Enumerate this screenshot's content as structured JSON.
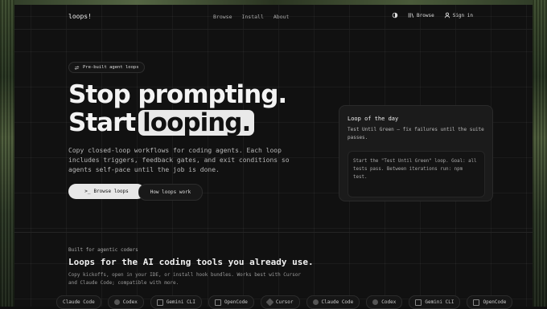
{
  "nav": {
    "logo": "loops!",
    "links": [
      "Browse",
      "Install",
      "About"
    ],
    "browse_label": "Browse",
    "signin_label": "Sign in"
  },
  "hero": {
    "badge": "Pre-built agent loops",
    "line1": "Stop prompting.",
    "line2_prefix": "Start",
    "line2_pill": "looping.",
    "lede": "Copy closed-loop workflows for coding agents. Each loop includes triggers, feedback gates, and exit conditions so agents self-pace until the job is done.",
    "primary_button": "Browse loops",
    "primary_prefix": ">_",
    "secondary_button": "How loops work"
  },
  "loop_of_day": {
    "title": "Loop of the day",
    "description": "Test Until Green — fix failures until the suite passes.",
    "prompt": "Start the \"Test Until Green\" loop. Goal: all tests pass. Between iterations run: npm test."
  },
  "section": {
    "eyebrow": "Built for agentic coders",
    "title": "Loops for the AI coding tools you already use.",
    "subtitle": "Copy kickoffs, open in your IDE, or install hook bundles. Works best with Cursor and Claude Code; compatible with more."
  },
  "tools": [
    {
      "label": "Claude Code",
      "icon": "claude-icon"
    },
    {
      "label": "Codex",
      "icon": "openai-icon"
    },
    {
      "label": "Gemini CLI",
      "icon": "terminal-icon"
    },
    {
      "label": "OpenCode",
      "icon": "opencode-icon"
    },
    {
      "label": "Cursor",
      "icon": "cursor-icon"
    },
    {
      "label": "Claude Code",
      "icon": "claude-icon"
    },
    {
      "label": "Codex",
      "icon": "openai-icon"
    },
    {
      "label": "Gemini CLI",
      "icon": "terminal-icon"
    },
    {
      "label": "OpenCode",
      "icon": "opencode-icon"
    }
  ]
}
